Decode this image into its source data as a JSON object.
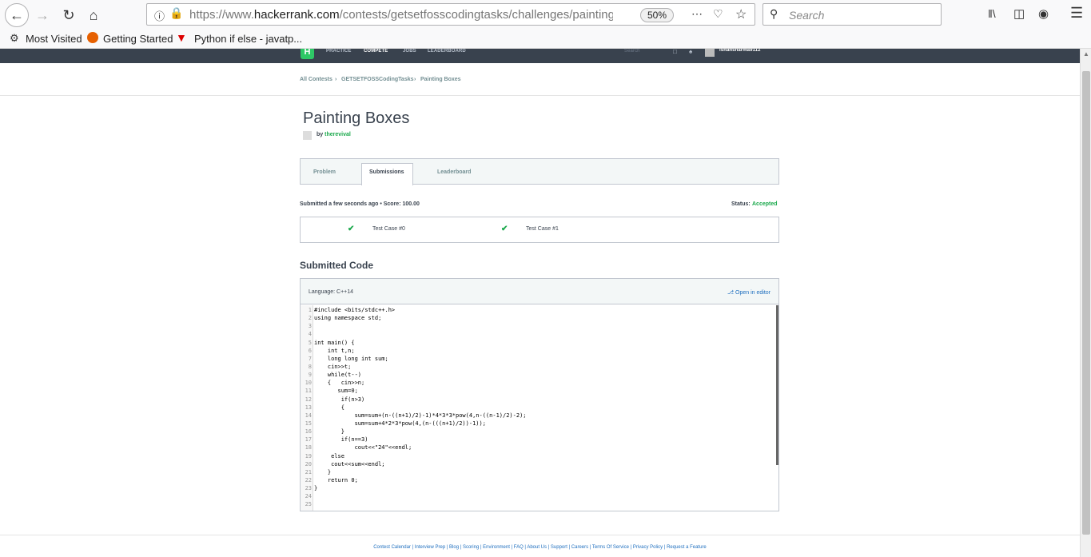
{
  "browser": {
    "url_prefix": "https://www.",
    "url_domain": "hackerrank.com",
    "url_path": "/contests/getsetfosscodingtasks/challenges/painting-boxe",
    "zoom": "50%",
    "search_placeholder": "Search"
  },
  "bookmarks": [
    "Most Visited",
    "Getting Started",
    "Python if else - javatp..."
  ],
  "site_nav": {
    "logo": "H",
    "links": [
      "PRACTICE",
      "COMPETE",
      "JOBS",
      "LEADERBOARD"
    ],
    "search": "Search",
    "username": "ishansharma9112"
  },
  "breadcrumb": [
    "All Contests",
    "GETSETFOSSCodingTasks",
    "Painting Boxes"
  ],
  "challenge": {
    "title": "Painting Boxes",
    "by_label": "by",
    "author": "therevival"
  },
  "tabs": [
    "Problem",
    "Submissions",
    "Leaderboard"
  ],
  "submission": {
    "summary": "Submitted a few seconds ago • Score: 100.00",
    "status_label": "Status:",
    "status_value": "Accepted",
    "test_cases": [
      "Test Case #0",
      "Test Case #1"
    ]
  },
  "code": {
    "heading": "Submitted Code",
    "language": "Language: C++14",
    "open_in_editor": "Open in editor",
    "lines": [
      "#include <bits/stdc++.h>",
      "using namespace std;",
      "",
      "",
      "int main() {",
      "    int t,n;",
      "    long long int sum;",
      "    cin>>t;",
      "    while(t--)",
      "    {   cin>>n;",
      "       sum=0;",
      "        if(n>3)",
      "        {",
      "            sum=sum+(n-((n+1)/2)-1)*4*3*3*pow(4,n-((n-1)/2)-2);",
      "            sum=sum+4*2*3*pow(4,(n-(((n+1)/2))-1));",
      "        }",
      "        if(n==3)",
      "            cout<<\"24\"<<endl;",
      "     else",
      "     cout<<sum<<endl;",
      "    }",
      "    return 0;",
      "}",
      "",
      ""
    ]
  },
  "footer": "Contest Calendar | Interview Prep | Blog | Scoring | Environment | FAQ | About Us | Support | Careers | Terms Of Service | Privacy Policy | Request a Feature"
}
